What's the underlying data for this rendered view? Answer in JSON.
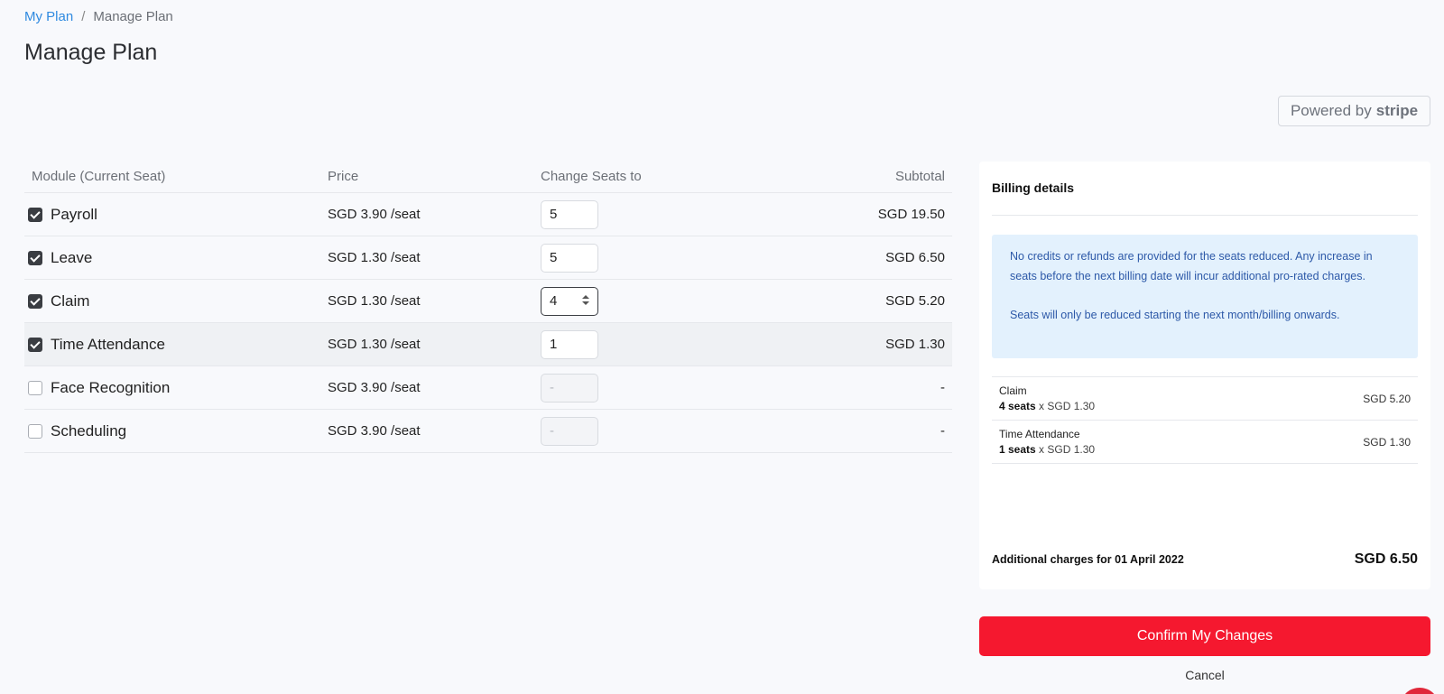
{
  "breadcrumb": {
    "parent": "My Plan",
    "separator": "/",
    "current": "Manage Plan"
  },
  "page_title": "Manage Plan",
  "stripe_badge": {
    "prefix": "Powered by",
    "brand": "stripe"
  },
  "table": {
    "headers": {
      "module": "Module (Current Seat)",
      "price": "Price",
      "seats": "Change Seats to",
      "subtotal": "Subtotal"
    },
    "rows": [
      {
        "name": "Payroll",
        "checked": true,
        "price": "SGD 3.90 /seat",
        "seats": "5",
        "subtotal": "SGD 19.50"
      },
      {
        "name": "Leave",
        "checked": true,
        "price": "SGD 1.30 /seat",
        "seats": "5",
        "subtotal": "SGD 6.50"
      },
      {
        "name": "Claim",
        "checked": true,
        "price": "SGD 1.30 /seat",
        "seats": "4",
        "subtotal": "SGD 5.20",
        "focused": true
      },
      {
        "name": "Time Attendance",
        "checked": true,
        "price": "SGD 1.30 /seat",
        "seats": "1",
        "subtotal": "SGD 1.30",
        "highlighted": true
      },
      {
        "name": "Face Recognition",
        "checked": false,
        "price": "SGD 3.90 /seat",
        "seats": "-",
        "subtotal": "-",
        "disabled": true
      },
      {
        "name": "Scheduling",
        "checked": false,
        "price": "SGD 3.90 /seat",
        "seats": "-",
        "subtotal": "-",
        "disabled": true
      }
    ]
  },
  "billing": {
    "title": "Billing details",
    "notice": [
      "No credits or refunds are provided for the seats reduced. Any increase in seats before the next billing date will incur additional pro-rated charges.",
      "Seats will only be reduced starting the next month/billing onwards."
    ],
    "line_items": [
      {
        "name": "Claim",
        "seats": "4 seats",
        "rate": "x SGD 1.30",
        "amount": "SGD 5.20"
      },
      {
        "name": "Time Attendance",
        "seats": "1 seats",
        "rate": "x SGD 1.30",
        "amount": "SGD 1.30"
      }
    ],
    "total_label": "Additional charges for 01 April 2022",
    "total_amount": "SGD 6.50"
  },
  "actions": {
    "confirm": "Confirm My Changes",
    "cancel": "Cancel"
  },
  "colors": {
    "primary": "#f5182f",
    "link": "#2f8ae0",
    "info_bg": "#e3f1fd",
    "info_text": "#2d59a8"
  }
}
